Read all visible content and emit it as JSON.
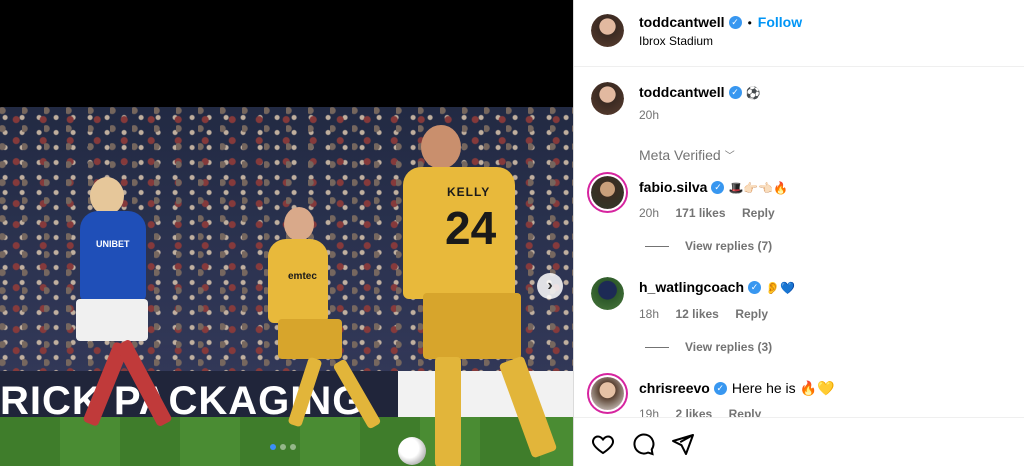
{
  "post": {
    "author": "toddcantwell",
    "follow_label": "Follow",
    "location": "Ibrox Stadium",
    "caption_emoji": "⚽",
    "time": "20h",
    "meta_verified_label": "Meta Verified",
    "photo_texts": {
      "shirt_sponsor_blue": "UNIBET",
      "shirt_sponsor_yellow": "emtec",
      "player_name": "KELLY",
      "player_number": "24",
      "hoarding": "RICK PACKAGING"
    },
    "carousel": {
      "dot_count": 3,
      "active_index": 0
    }
  },
  "comments": [
    {
      "username": "fabio.silva",
      "text": "🎩👉🏻👈🏻🔥",
      "time": "20h",
      "likes": "171 likes",
      "reply_label": "Reply",
      "view_replies": "View replies (7)"
    },
    {
      "username": "h_watlingcoach",
      "text": "👂💙",
      "time": "18h",
      "likes": "12 likes",
      "reply_label": "Reply",
      "view_replies": "View replies (3)"
    },
    {
      "username": "chrisreevo",
      "text": "Here he is 🔥💛",
      "time": "19h",
      "likes": "2 likes",
      "reply_label": "Reply"
    }
  ],
  "icons": {
    "verified": "verified-badge-icon",
    "like": "heart-icon",
    "comment": "comment-icon",
    "share": "send-icon",
    "next": "chevron-right-icon"
  },
  "colors": {
    "link": "#0095f6",
    "verified": "#3897f0",
    "muted": "#737373",
    "active_dot": "#3b8ff6"
  }
}
